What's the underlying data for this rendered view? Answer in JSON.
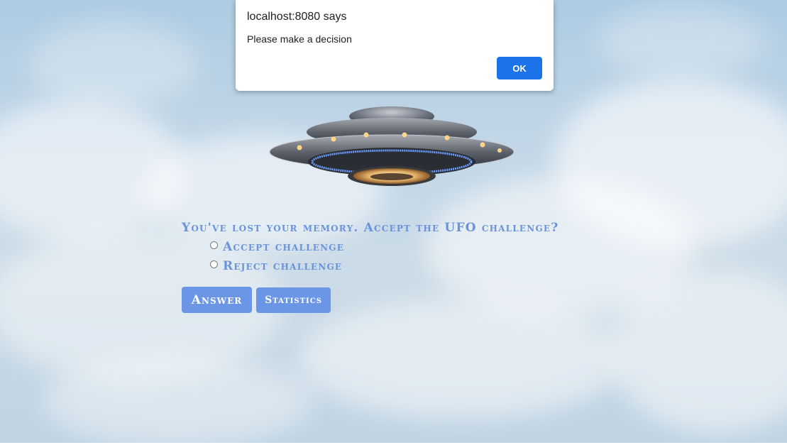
{
  "dialog": {
    "title": "localhost:8080 says",
    "message": "Please make a decision",
    "ok_label": "OK"
  },
  "game": {
    "question": "You've lost your memory. Accept the UFO challenge?",
    "options": [
      {
        "label": "Accept challenge",
        "checked": false
      },
      {
        "label": "Reject challenge",
        "checked": false
      }
    ],
    "answer_label": "Answer",
    "statistics_label": "Statistics"
  },
  "colors": {
    "accent_text": "#6a93d9",
    "button_bg": "#6b96e6",
    "dialog_ok_bg": "#1a73e8"
  },
  "icons": {
    "background": "sky-clouds-background",
    "ufo": "ufo-image"
  }
}
